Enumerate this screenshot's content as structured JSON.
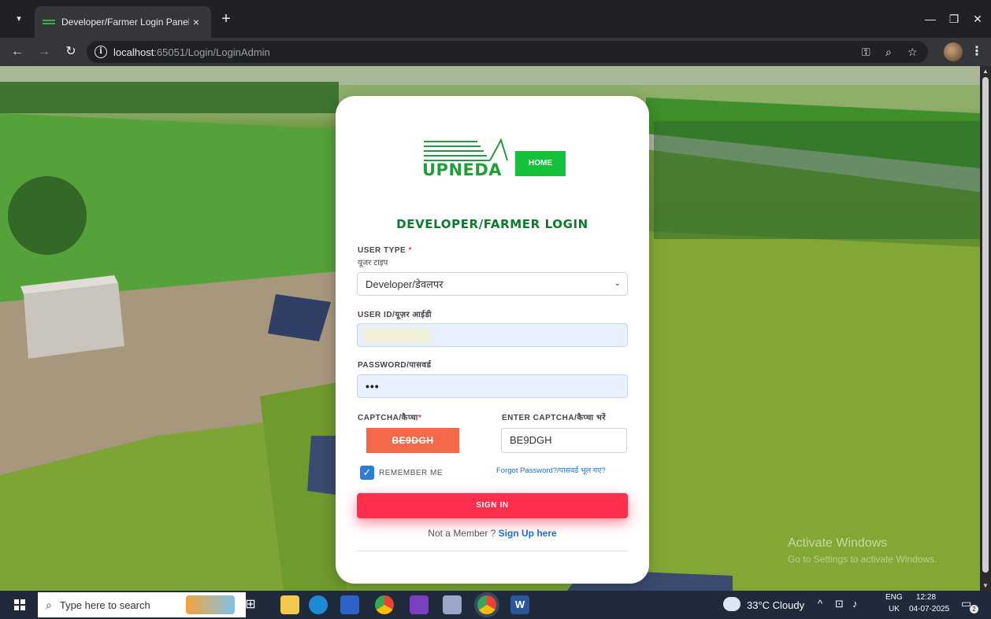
{
  "browser": {
    "tab_title": "Developer/Farmer Login Panel",
    "tab_close": "×",
    "new_tab": "+",
    "url_host": "localhost",
    "url_rest": ":65051/Login/LoginAdmin"
  },
  "page": {
    "logo_text": "UPNEDA",
    "home_label": "HOME",
    "title": "DEVELOPER/FARMER LOGIN",
    "user_type_label": "USER TYPE",
    "required_mark": "*",
    "user_type_hindi": "यूजर टाइप",
    "user_type_value": "Developer/डेवलपर",
    "user_id_label": "USER ID/यूज़र आईडी",
    "password_label": "PASSWORD/पासवर्ड",
    "password_value": "•••",
    "captcha_label": "CAPTCHA/कैप्चा",
    "captcha_code": "BE9DGH",
    "enter_captcha_label": "ENTER CAPTCHA/कैप्चा भरें",
    "enter_captcha_value": "BE9DGH",
    "remember_label": "REMEMBER ME",
    "forgot_label": "Forgot Password?/पासवर्ड भूल गए?",
    "signin_label": "SIGN IN",
    "not_member": "Not a Member ? ",
    "signup_label": "Sign Up here"
  },
  "desktop": {
    "watermark_title": "Activate Windows",
    "watermark_sub": "Go to Settings to activate Windows."
  },
  "taskbar": {
    "search_placeholder": "Type here to search",
    "weather": "33°C  Cloudy",
    "lang_top": "ENG",
    "lang_bottom": "UK",
    "time": "12:28",
    "date": "04-07-2025",
    "notification_count": "2"
  },
  "colors": {
    "accent_green": "#0b7a2b",
    "home_green": "#16c13b",
    "signin_red": "#fe2e4d",
    "captcha_orange": "#f4694a",
    "link_blue": "#1a6fd1"
  }
}
